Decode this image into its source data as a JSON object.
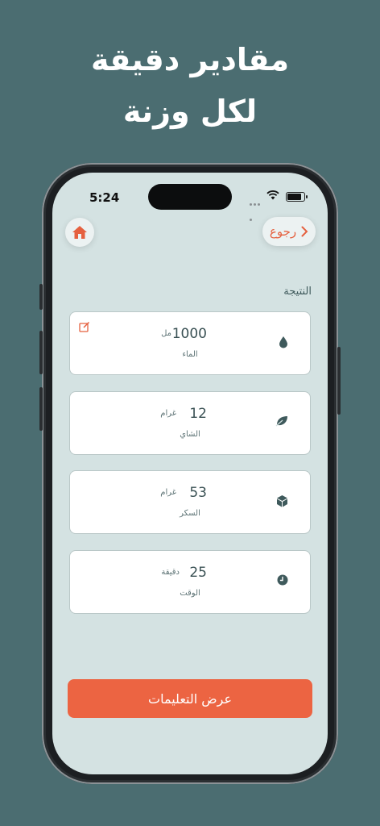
{
  "headline": {
    "line1": "مقادير دقيقة",
    "line2": "لكل وزنة"
  },
  "status": {
    "time": "5:24"
  },
  "nav": {
    "back_label": "رجوع"
  },
  "result_title": "النتيجة",
  "items": [
    {
      "value": "1000",
      "unit": "مل",
      "name": "الماء",
      "icon": "water-drop-icon"
    },
    {
      "value": "12",
      "unit": "غرام",
      "name": "الشاي",
      "icon": "leaf-icon"
    },
    {
      "value": "53",
      "unit": "غرام",
      "name": "السكر",
      "icon": "sugar-cube-icon"
    },
    {
      "value": "25",
      "unit": "دقيقة",
      "name": "الوقت",
      "icon": "clock-icon"
    }
  ],
  "cta_label": "عرض التعليمات",
  "colors": {
    "background": "#4b6d71",
    "accent": "#ec6442",
    "screen": "#d4e2e2",
    "icon": "#3f5a5c"
  }
}
